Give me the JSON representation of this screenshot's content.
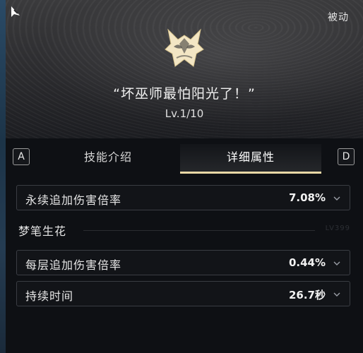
{
  "header": {
    "passive_label": "被动",
    "skill_quote": "“坏巫师最怕阳光了！”",
    "level_text": "Lv.1/10",
    "emblem_icon": "witch-mask-emblem-icon",
    "corner_icon": "cursor-arrow-icon",
    "emblem_color": "#f3e6c4"
  },
  "tabs": {
    "key_left": "A",
    "key_right": "D",
    "items": [
      {
        "label": "技能介绍",
        "active": false
      },
      {
        "label": "详细属性",
        "active": true
      }
    ],
    "active_underline_color": "#e9d8a6"
  },
  "stats": {
    "primary": {
      "label": "永续追加伤害倍率",
      "value": "7.08%"
    },
    "section": {
      "title": "梦笔生花",
      "mark": "LV399"
    },
    "secondary": [
      {
        "label": "每层追加伤害倍率",
        "value": "0.44%"
      },
      {
        "label": "持续时间",
        "value": "26.7秒"
      }
    ]
  }
}
